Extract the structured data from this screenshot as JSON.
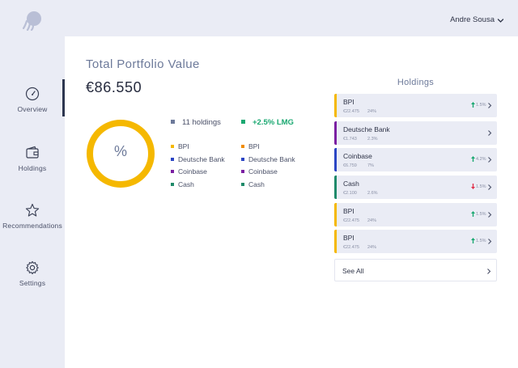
{
  "sidebar": {
    "logo_icon": "jellyfish-logo-icon",
    "items": [
      {
        "label": "Overview",
        "icon": "speedometer-icon",
        "active": true
      },
      {
        "label": "Holdings",
        "icon": "wallet-icon",
        "active": false
      },
      {
        "label": "Recommendations",
        "icon": "star-icon",
        "active": false
      },
      {
        "label": "Settings",
        "icon": "gear-icon",
        "active": false
      }
    ]
  },
  "header": {
    "user_name": "Andre Sousa",
    "user_menu_icon": "chevron-down-icon"
  },
  "portfolio": {
    "title": "Total Portfolio Value",
    "value": "€86.550",
    "donut_label": "%",
    "holdings_count": "11 holdings",
    "change": "+2.5% LMG",
    "legend_left": [
      {
        "label": "BPI",
        "color": "#f5b800"
      },
      {
        "label": "Deutsche Bank",
        "color": "#2b45c4"
      },
      {
        "label": "Coinbase",
        "color": "#7b1fa2"
      },
      {
        "label": "Cash",
        "color": "#1f8a6a"
      }
    ],
    "legend_right": [
      {
        "label": "BPI",
        "color": "#f08c00"
      },
      {
        "label": "Deutsche Bank",
        "color": "#2b45c4"
      },
      {
        "label": "Coinbase",
        "color": "#7b1fa2"
      },
      {
        "label": "Cash",
        "color": "#1f8a6a"
      }
    ]
  },
  "holdings": {
    "title": "Holdings",
    "cards": [
      {
        "name": "BPI",
        "amount": "€22.475",
        "share": "24%",
        "change": "1.5%",
        "trend": "up",
        "color": "#f5b800"
      },
      {
        "name": "Deutsche Bank",
        "amount": "€1.743",
        "share": "2.3%",
        "change": "",
        "trend": "none",
        "color": "#7b1fa2"
      },
      {
        "name": "Coinbase",
        "amount": "€6.759",
        "share": "7%",
        "change": "4.2%",
        "trend": "up",
        "color": "#2b45c4"
      },
      {
        "name": "Cash",
        "amount": "€2.100",
        "share": "2.6%",
        "change": "1.5%",
        "trend": "down",
        "color": "#1f8a6a"
      },
      {
        "name": "BPI",
        "amount": "€22.475",
        "share": "24%",
        "change": "1.5%",
        "trend": "up",
        "color": "#f5b800"
      },
      {
        "name": "BPI",
        "amount": "€22.475",
        "share": "24%",
        "change": "1.5%",
        "trend": "up",
        "color": "#f5b800"
      }
    ],
    "see_all": "See All"
  },
  "colors": {
    "accent_gold": "#f5b800",
    "positive": "#1aa871",
    "negative": "#e0314b",
    "sidebar_bg": "#eaecf5"
  }
}
